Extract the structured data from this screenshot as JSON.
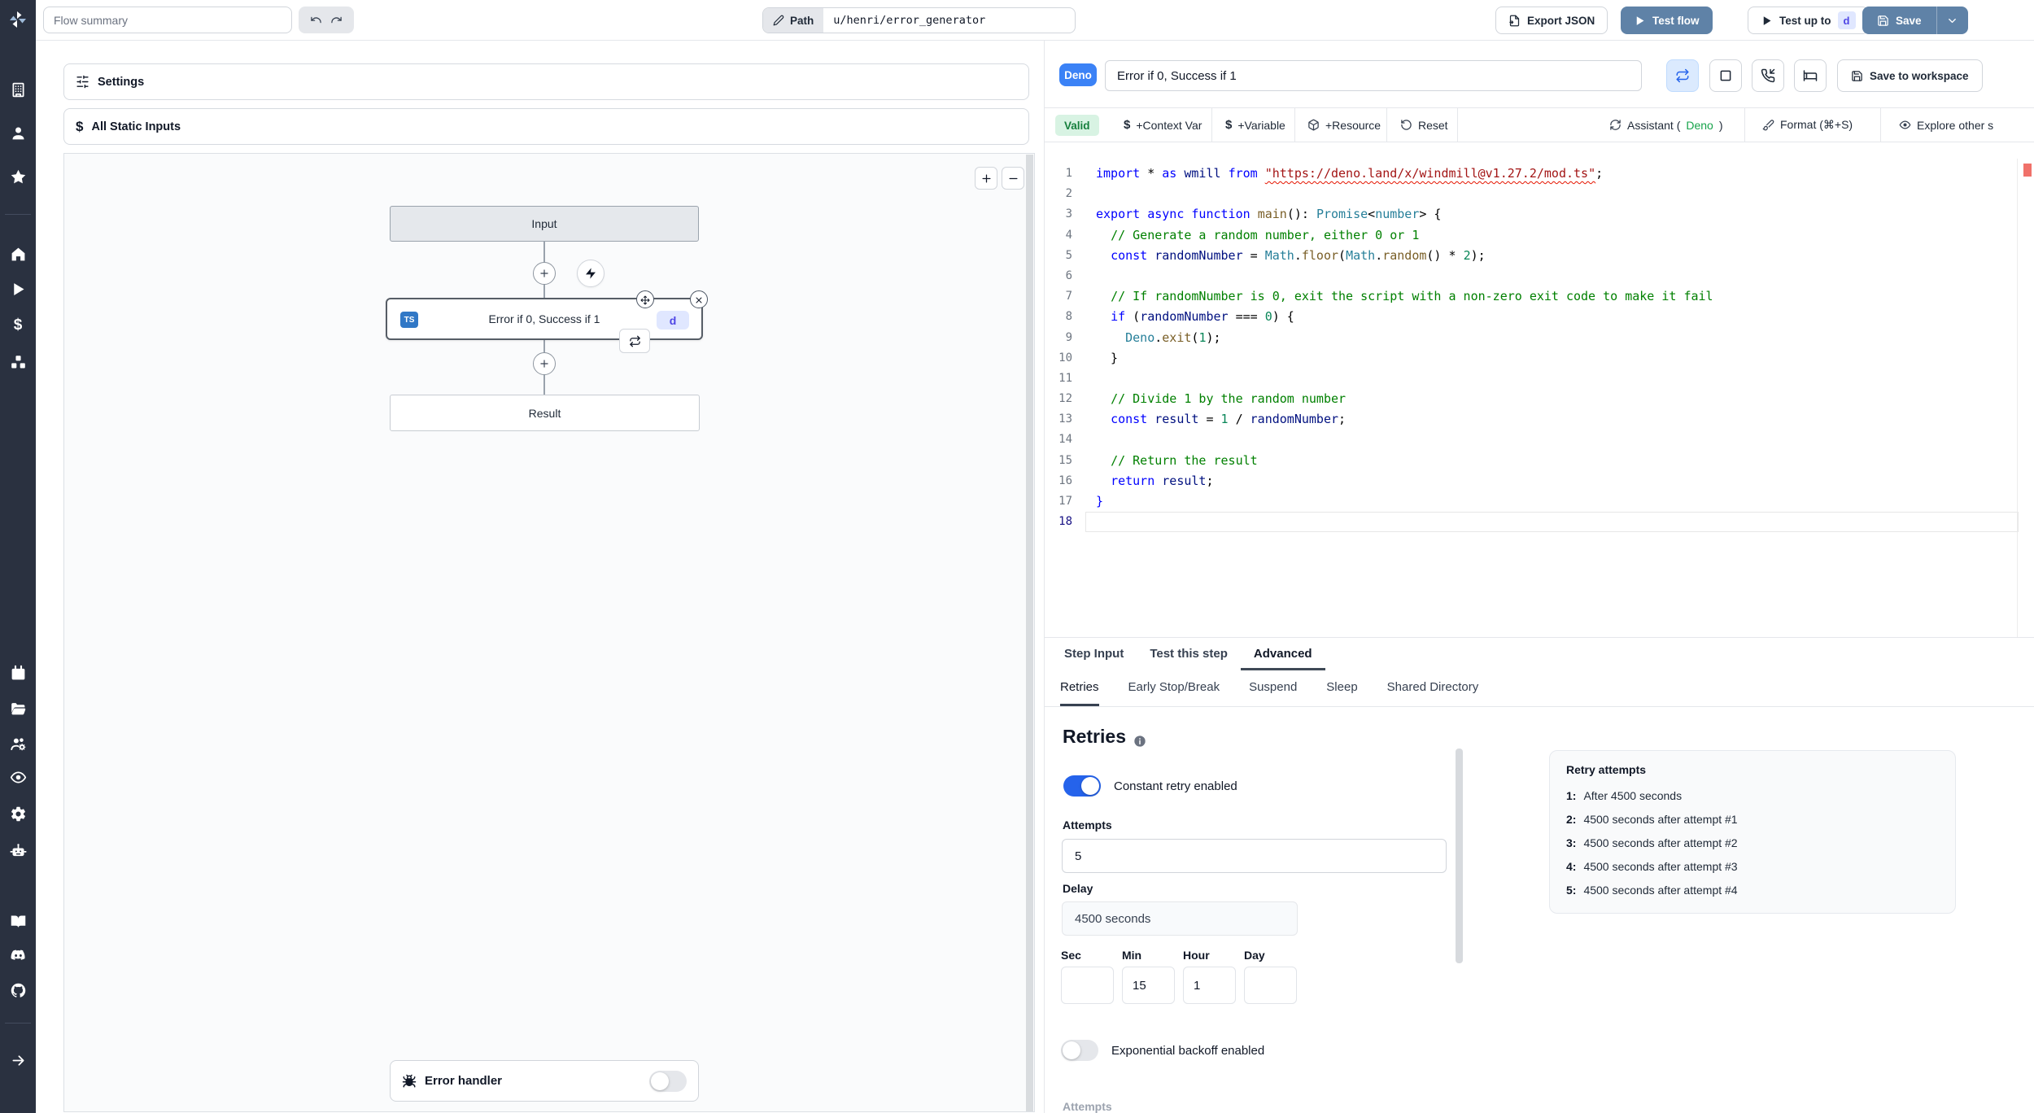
{
  "colors": {
    "sidebar_bg": "#2a3140",
    "steel_blue": "#5f82a7",
    "primary_blue": "#3b82f6",
    "toggle_on": "#2563eb",
    "valid_bg": "#d8f3e3",
    "valid_text": "#157f3c",
    "badge_indigo_bg": "#e0e7ff",
    "badge_indigo_text": "#4f46e5",
    "ts_badge_bg": "#3178c6",
    "deno_green": "#16a34a",
    "error_marker": "#f0716a"
  },
  "topbar": {
    "flow_summary_placeholder": "Flow summary",
    "path_label": "Path",
    "path_value": "u/henri/error_generator",
    "export_json_label": "Export JSON",
    "test_flow_label": "Test flow",
    "test_up_to_label": "Test up to",
    "test_up_to_badge": "d",
    "save_label": "Save"
  },
  "sidebar": {
    "items": [
      {
        "name": "workspace",
        "icon": "building"
      },
      {
        "name": "user",
        "icon": "user"
      },
      {
        "name": "favorites",
        "icon": "star"
      },
      {
        "name": "home",
        "icon": "home"
      },
      {
        "name": "runs",
        "icon": "play"
      },
      {
        "name": "variables",
        "icon": "dollar"
      },
      {
        "name": "resources",
        "icon": "boxes"
      },
      {
        "name": "schedules",
        "icon": "calendar"
      },
      {
        "name": "folders",
        "icon": "folder"
      },
      {
        "name": "groups",
        "icon": "users"
      },
      {
        "name": "audit-logs",
        "icon": "eye"
      },
      {
        "name": "settings",
        "icon": "gear"
      },
      {
        "name": "workers",
        "icon": "bot"
      },
      {
        "name": "docs",
        "icon": "book"
      },
      {
        "name": "discord",
        "icon": "discord"
      },
      {
        "name": "github",
        "icon": "github"
      },
      {
        "name": "expand",
        "icon": "arrow-right"
      }
    ]
  },
  "left_panel": {
    "settings_label": "Settings",
    "static_inputs_label": "All Static Inputs",
    "flow": {
      "input_label": "Input",
      "module_label": "Error if 0, Success if 1",
      "module_lang_badge": "TS",
      "module_badge": "d",
      "result_label": "Result",
      "error_handler_label": "Error handler"
    }
  },
  "editor": {
    "lang_badge": "Deno",
    "summary_value": "Error if 0, Success if 1",
    "save_to_workspace_label": "Save to workspace",
    "toolbar": [
      {
        "type": "status",
        "label": "Valid"
      },
      {
        "icon": "dollar",
        "label": "+Context Var"
      },
      {
        "icon": "dollar",
        "label": "+Variable"
      },
      {
        "icon": "box",
        "label": "+Resource"
      },
      {
        "icon": "rotate-ccw",
        "label": "Reset"
      },
      {
        "icon": "refresh",
        "label_prefix": "Assistant (",
        "label_accent": "Deno",
        "label_suffix": ")"
      },
      {
        "icon": "brush",
        "label": "Format (⌘+S)"
      },
      {
        "icon": "eye",
        "label": "Explore other s"
      }
    ],
    "code_lines": [
      {
        "tokens": [
          [
            "k",
            "import"
          ],
          [
            "p",
            " * "
          ],
          [
            "k",
            "as"
          ],
          [
            "p",
            " "
          ],
          [
            "v",
            "wmill"
          ],
          [
            "p",
            " "
          ],
          [
            "k",
            "from"
          ],
          [
            "p",
            " "
          ],
          [
            "su",
            "\"https://deno.land/x/windmill@v1.27.2/mod.ts\""
          ],
          [
            "p",
            ";"
          ]
        ]
      },
      {
        "tokens": []
      },
      {
        "tokens": [
          [
            "k",
            "export"
          ],
          [
            "p",
            " "
          ],
          [
            "k",
            "async"
          ],
          [
            "p",
            " "
          ],
          [
            "k",
            "function"
          ],
          [
            "p",
            " "
          ],
          [
            "f",
            "main"
          ],
          [
            "p",
            "(): "
          ],
          [
            "t",
            "Promise"
          ],
          [
            "p",
            "<"
          ],
          [
            "t",
            "number"
          ],
          [
            "p",
            "> {"
          ]
        ]
      },
      {
        "tokens": [
          [
            "p",
            "  "
          ],
          [
            "c",
            "// Generate a random number, either 0 or 1"
          ]
        ]
      },
      {
        "tokens": [
          [
            "p",
            "  "
          ],
          [
            "k",
            "const"
          ],
          [
            "p",
            " "
          ],
          [
            "v",
            "randomNumber"
          ],
          [
            "p",
            " = "
          ],
          [
            "t",
            "Math"
          ],
          [
            "p",
            "."
          ],
          [
            "f",
            "floor"
          ],
          [
            "p",
            "("
          ],
          [
            "t",
            "Math"
          ],
          [
            "p",
            "."
          ],
          [
            "f",
            "random"
          ],
          [
            "p",
            "() * "
          ],
          [
            "n",
            "2"
          ],
          [
            "p",
            ");"
          ]
        ]
      },
      {
        "tokens": []
      },
      {
        "tokens": [
          [
            "p",
            "  "
          ],
          [
            "c",
            "// If randomNumber is 0, exit the script with a non-zero exit code to make it fail"
          ]
        ]
      },
      {
        "tokens": [
          [
            "p",
            "  "
          ],
          [
            "k",
            "if"
          ],
          [
            "p",
            " ("
          ],
          [
            "v",
            "randomNumber"
          ],
          [
            "p",
            " === "
          ],
          [
            "n",
            "0"
          ],
          [
            "p",
            ") {"
          ]
        ]
      },
      {
        "tokens": [
          [
            "p",
            "    "
          ],
          [
            "t",
            "Deno"
          ],
          [
            "p",
            "."
          ],
          [
            "f",
            "exit"
          ],
          [
            "p",
            "("
          ],
          [
            "n",
            "1"
          ],
          [
            "p",
            ");"
          ]
        ]
      },
      {
        "tokens": [
          [
            "p",
            "  }"
          ]
        ]
      },
      {
        "tokens": []
      },
      {
        "tokens": [
          [
            "p",
            "  "
          ],
          [
            "c",
            "// Divide 1 by the random number"
          ]
        ]
      },
      {
        "tokens": [
          [
            "p",
            "  "
          ],
          [
            "k",
            "const"
          ],
          [
            "p",
            " "
          ],
          [
            "v",
            "result"
          ],
          [
            "p",
            " = "
          ],
          [
            "n",
            "1"
          ],
          [
            "p",
            " / "
          ],
          [
            "v",
            "randomNumber"
          ],
          [
            "p",
            ";"
          ]
        ]
      },
      {
        "tokens": []
      },
      {
        "tokens": [
          [
            "p",
            "  "
          ],
          [
            "c",
            "// Return the result"
          ]
        ]
      },
      {
        "tokens": [
          [
            "p",
            "  "
          ],
          [
            "k",
            "return"
          ],
          [
            "p",
            " "
          ],
          [
            "v",
            "result"
          ],
          [
            "p",
            ";"
          ]
        ]
      },
      {
        "tokens": [
          [
            "k",
            "}"
          ]
        ]
      },
      {
        "active": true,
        "tokens": []
      }
    ]
  },
  "tabs": {
    "main": [
      "Step Input",
      "Test this step",
      "Advanced"
    ],
    "main_active": "Advanced",
    "sub": [
      "Retries",
      "Early Stop/Break",
      "Suspend",
      "Sleep",
      "Shared Directory"
    ],
    "sub_active": "Retries"
  },
  "retries": {
    "title": "Retries",
    "constant_toggle_label": "Constant retry enabled",
    "constant_toggle_on": true,
    "attempts_label": "Attempts",
    "attempts_value": "5",
    "delay_label": "Delay",
    "delay_value": "4500 seconds",
    "time_fields": [
      {
        "label": "Sec",
        "value": ""
      },
      {
        "label": "Min",
        "value": "15"
      },
      {
        "label": "Hour",
        "value": "1"
      },
      {
        "label": "Day",
        "value": ""
      }
    ],
    "exponential_toggle_label": "Exponential backoff enabled",
    "exponential_toggle_on": false,
    "clipped_label": "Attempts",
    "preview": {
      "title": "Retry attempts",
      "items": [
        {
          "n": "1:",
          "text": "After 4500 seconds"
        },
        {
          "n": "2:",
          "text": "4500 seconds after attempt #1"
        },
        {
          "n": "3:",
          "text": "4500 seconds after attempt #2"
        },
        {
          "n": "4:",
          "text": "4500 seconds after attempt #3"
        },
        {
          "n": "5:",
          "text": "4500 seconds after attempt #4"
        }
      ]
    }
  }
}
